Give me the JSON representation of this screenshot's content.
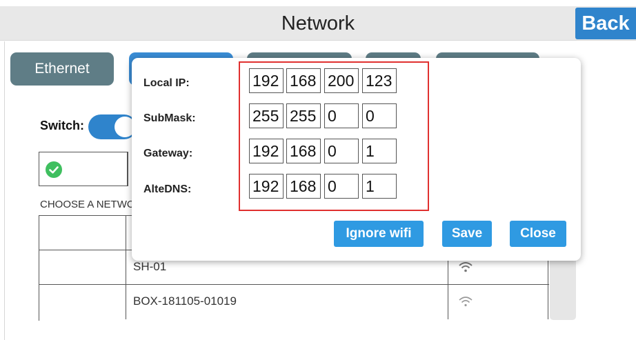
{
  "header": {
    "title": "Network",
    "back_label": "Back"
  },
  "tabs": {
    "ethernet_label": "Ethernet"
  },
  "switch": {
    "label": "Switch:",
    "on": true
  },
  "network_list": {
    "heading": "CHOOSE A NETWORK",
    "rows": [
      {
        "name": ""
      },
      {
        "name": "SH-01"
      },
      {
        "name": "BOX-181105-01019"
      }
    ]
  },
  "dialog": {
    "fields": [
      {
        "label": "Local IP:",
        "octets": [
          "192",
          "168",
          "200",
          "123"
        ]
      },
      {
        "label": "SubMask:",
        "octets": [
          "255",
          "255",
          "0",
          "0"
        ]
      },
      {
        "label": "Gateway:",
        "octets": [
          "192",
          "168",
          "0",
          "1"
        ]
      },
      {
        "label": "AlteDNS:",
        "octets": [
          "192",
          "168",
          "0",
          "1"
        ]
      }
    ],
    "ignore_label": "Ignore wifi",
    "save_label": "Save",
    "close_label": "Close"
  },
  "colors": {
    "primary": "#2f84cc",
    "button": "#2f9ae2",
    "tab_inactive": "#5f7d86",
    "highlight_border": "#e0302f",
    "success": "#3fbf5f"
  },
  "icons": {
    "status": "check-circle-icon",
    "wifi": "wifi-icon"
  }
}
